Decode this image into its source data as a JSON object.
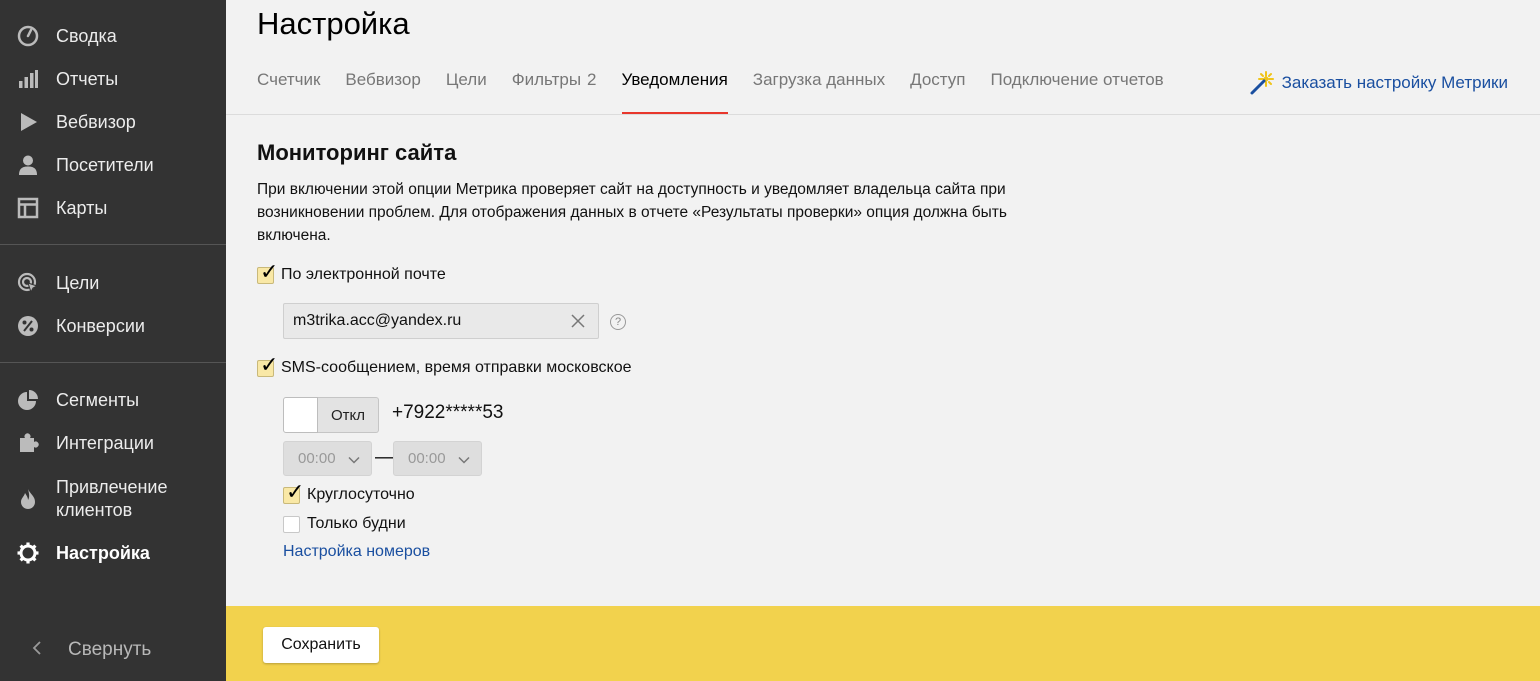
{
  "sidebar": {
    "items": [
      {
        "label": "Сводка",
        "icon": "gauge-icon"
      },
      {
        "label": "Отчеты",
        "icon": "bar-chart-icon"
      },
      {
        "label": "Вебвизор",
        "icon": "play-icon"
      },
      {
        "label": "Посетители",
        "icon": "person-icon"
      },
      {
        "label": "Карты",
        "icon": "layout-icon"
      },
      {
        "label": "Цели",
        "icon": "target-cursor-icon"
      },
      {
        "label": "Конверсии",
        "icon": "percent-icon"
      },
      {
        "label": "Сегменты",
        "icon": "pie-icon"
      },
      {
        "label": "Интеграции",
        "icon": "puzzle-icon"
      },
      {
        "label": "Привлечение клиентов",
        "icon": "flame-icon"
      },
      {
        "label": "Настройка",
        "icon": "gear-icon",
        "active": true
      }
    ],
    "collapse_label": "Свернуть"
  },
  "header": {
    "title": "Настройка",
    "tabs": [
      {
        "label": "Счетчик"
      },
      {
        "label": "Вебвизор"
      },
      {
        "label": "Цели"
      },
      {
        "label": "Фильтры",
        "count": "2"
      },
      {
        "label": "Уведомления",
        "active": true
      },
      {
        "label": "Загрузка данных"
      },
      {
        "label": "Доступ"
      },
      {
        "label": "Подключение отчетов"
      }
    ],
    "order_link": "Заказать настройку Метрики"
  },
  "monitoring": {
    "title": "Мониторинг сайта",
    "description": "При включении этой опции Метрика проверяет сайт на доступность и уведомляет владельца сайта при возникновении проблем. Для отображения данных в отчете «Результаты проверки» опция должна быть включена.",
    "email_checkbox": {
      "label": "По электронной почте",
      "checked": true
    },
    "email_value": "m3trika.acc@yandex.ru",
    "help_symbol": "?",
    "sms_checkbox": {
      "label": "SMS-сообщением, время отправки московское",
      "checked": true
    },
    "sms_toggle_state": "Откл",
    "phone": "+7922*****53",
    "time_from": "00:00",
    "time_to": "00:00",
    "time_separator": "—",
    "round_clock": {
      "label": "Круглосуточно",
      "checked": true
    },
    "weekdays_only": {
      "label": "Только будни",
      "checked": false
    },
    "numbers_link": "Настройка номеров"
  },
  "footer": {
    "save_label": "Сохранить"
  },
  "colors": {
    "sidebar_bg": "#333333",
    "accent_tab": "#e8372c",
    "footer_bg": "#f2d24d",
    "link": "#1a4fa0",
    "checkbox_fill": "#f9e8a6"
  }
}
